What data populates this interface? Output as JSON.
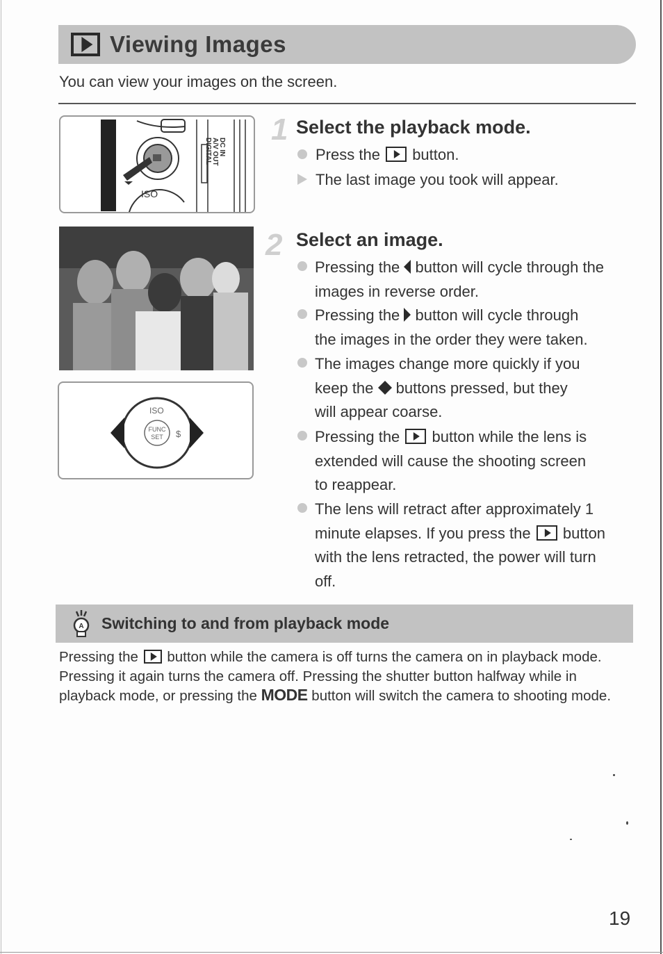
{
  "header": {
    "icon": "playback-icon",
    "title": "Viewing Images",
    "intro": "You can view your images on the screen."
  },
  "illustrations": {
    "camera_back_labels": [
      "DC IN",
      "A/V OUT",
      "DIGITAL"
    ],
    "dial_labels": {
      "top": "ISO",
      "center_line1": "FUNC",
      "center_line2": "SET",
      "right": "$"
    }
  },
  "steps": [
    {
      "number": "1",
      "title": "Select the playback mode.",
      "items": [
        {
          "type": "bullet",
          "parts": [
            "Press the",
            "button."
          ]
        },
        {
          "type": "result",
          "text": "The last image you took will appear."
        }
      ]
    },
    {
      "number": "2",
      "title": "Select an image.",
      "items": [
        {
          "type": "bullet",
          "before": "Pressing the",
          "after": "button will cycle through the",
          "line2": "images in reverse order."
        },
        {
          "type": "bullet",
          "before": "Pressing the",
          "after": "button will cycle through",
          "line2": "the images in the order they were taken."
        },
        {
          "type": "bullet",
          "line1": "The images change more quickly if you",
          "before": "keep the",
          "after": "buttons pressed, but they",
          "line3": "will appear coarse."
        },
        {
          "type": "bullet",
          "before": "Pressing the",
          "after": "button while the lens is",
          "line2": "extended will cause the shooting screen",
          "line3": "to reappear."
        },
        {
          "type": "bullet",
          "line1": "The lens will retract after approximately 1",
          "before": "minute elapses. If you press the",
          "after": "button",
          "line3": "with the lens retracted, the power will turn",
          "line4": "off."
        }
      ]
    }
  ],
  "tip": {
    "icon": "lightbulb-icon",
    "title": "Switching to and from playback mode",
    "body_1": "Pressing the",
    "body_2": "button while the camera is off turns the camera on in playback mode. Pressing it again turns the camera off. Pressing the shutter button halfway while in playback mode, or pressing the",
    "mode_word": "MODE",
    "body_3": "button will switch the camera to shooting mode."
  },
  "page_number": "19"
}
